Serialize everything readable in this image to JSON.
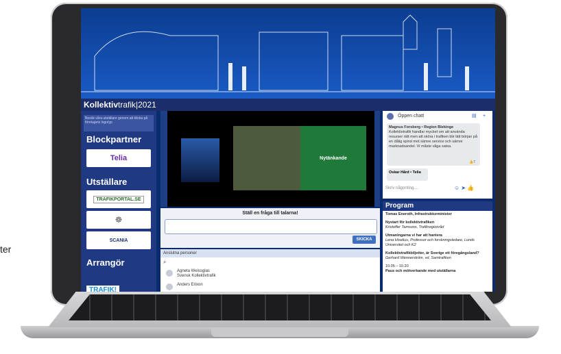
{
  "outside_text": "ter",
  "brand": {
    "logo_bold": "Kollektiv",
    "logo_thin": "trafik|2021"
  },
  "sidebar": {
    "note": "Besök våra utställare genom att klicka på företagets logotyp",
    "blockpartner_heading": "Blockpartner",
    "blockpartner_logo": "Telia",
    "exhibitors_heading": "Utställare",
    "exhibitors": [
      "TRAFIKPORTAL.SE",
      "SCANIA"
    ],
    "organizer_heading": "Arrangör",
    "organizer_logo": "TRAFIK!"
  },
  "video": {
    "slide_text": "Nytänkande"
  },
  "ask": {
    "title": "Ställ en fråga till talarna!",
    "submit": "SKICKA"
  },
  "people": {
    "header": "Anslutna personer",
    "rows": [
      {
        "name": "Agneta Weissglas",
        "org": "Svensk Kollektivtrafik"
      },
      {
        "name": "Anders Erixon",
        "org": ""
      }
    ]
  },
  "chat": {
    "title": "Öppen chatt",
    "msg1_author": "Magnus Forsberg • Region Blekinge",
    "msg1_text": "Kollektivtrafik handlar mycket om att använda resurser rätt men att sköra i trafiken blir lätt början på en dålig spiral mot sämre service och sämre marknadsandel. Vi måste våga satsa.",
    "msg2_author": "Oskar Hård • Telia",
    "placeholder": "Skriv någonting....",
    "like_count": "7"
  },
  "program": {
    "title": "Program",
    "items": [
      {
        "line1": "Tomas Eneroth, Infrastrukturminister",
        "line2": ""
      },
      {
        "line1": "Nystart för kollektivtrafiken",
        "line2": "Kristoffer Tamsons, Trafikregionråd"
      },
      {
        "line1": "Utmaningarna vi har att hantera",
        "line2": "Lena Hiselius, Professor och forskningsledare, Lunds Universitet och K2"
      },
      {
        "line1": "Kollektivtrafikbiljetter, är Sverige ett föregångsland?",
        "line2": "Gerhard Wennerström, vd, Samtrafiken"
      },
      {
        "line1": "10.05 – 10.20",
        "line2": "Paus och mötverkande med utställarna"
      }
    ]
  }
}
